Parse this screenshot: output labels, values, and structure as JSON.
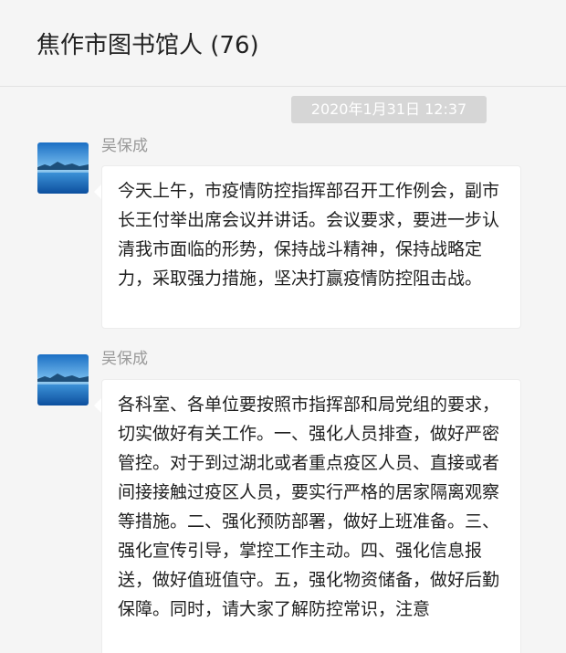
{
  "window": {
    "title": "焦作市图书馆人 (76)"
  },
  "timestamp": "2020年1月31日  12:37",
  "messages": [
    {
      "sender": "吴保成",
      "avatar_icon": "landscape-avatar-icon",
      "text": "今天上午，市疫情防控指挥部召开工作例会，副市长王付举出席会议并讲话。会议要求，要进一步认清我市面临的形势，保持战斗精神，保持战略定力，采取强力措施，坚决打赢疫情防控阻击战。"
    },
    {
      "sender": "吴保成",
      "avatar_icon": "landscape-avatar-icon",
      "text": "各科室、各单位要按照市指挥部和局党组的要求，切实做好有关工作。一、强化人员排查，做好严密管控。对于到过湖北或者重点疫区人员、直接或者间接接触过疫区人员，要实行严格的居家隔离观察等措施。二、强化预防部署，做好上班准备。三、强化宣传引导，掌控工作主动。四、强化信息报送，做好值班值守。五，强化物资储备，做好后勤保障。同时，请大家了解防控常识，注意"
    }
  ],
  "colors": {
    "background": "#f5f5f5",
    "bubble": "#ffffff",
    "timestamp_bg": "#d6d6d6",
    "sender_text": "#999999"
  }
}
